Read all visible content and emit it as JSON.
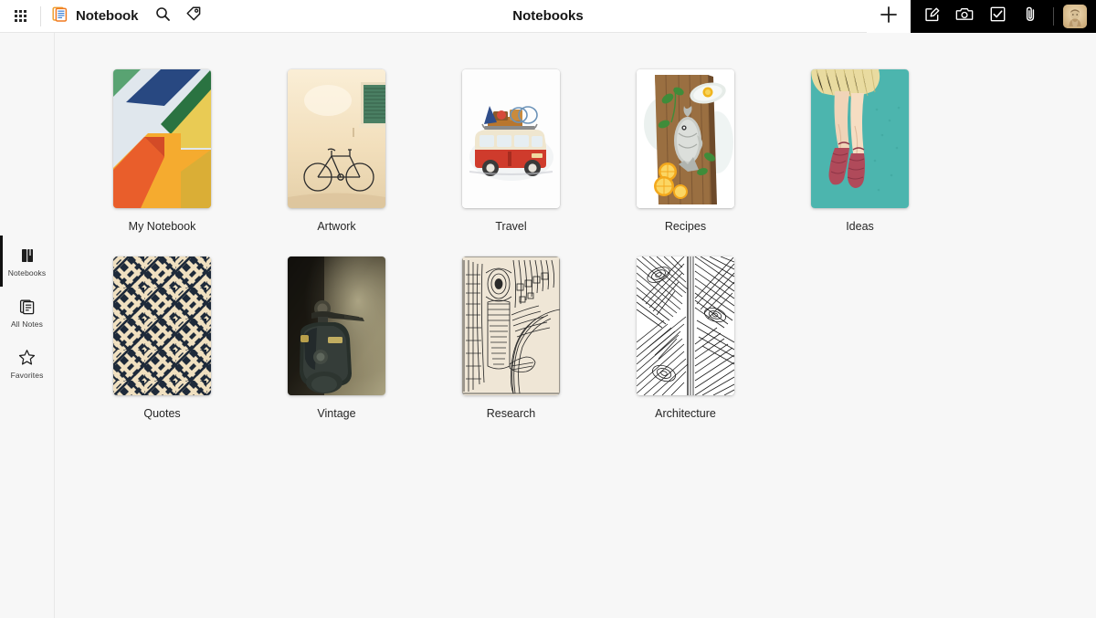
{
  "window": {
    "background": "#f7f7f7",
    "topbar_background": "#ffffff",
    "toolbar_background": "#000000"
  },
  "topbar": {
    "apps_grid_icon": "apps-grid-icon",
    "brand_icon": "notebook-app-icon",
    "brand_title": "Notebook",
    "search_icon": "search-icon",
    "tag_icon": "tag-icon",
    "page_title": "Notebooks",
    "plus_icon": "plus-icon",
    "tools": [
      {
        "name": "new-note",
        "icon": "edit-square-icon"
      },
      {
        "name": "camera-note",
        "icon": "camera-icon"
      },
      {
        "name": "checklist-note",
        "icon": "checkbox-icon"
      },
      {
        "name": "attachment-note",
        "icon": "paperclip-icon"
      }
    ],
    "avatar_name": "user-avatar"
  },
  "sidebar": {
    "items": [
      {
        "label": "Notebooks",
        "icon": "notebooks-icon",
        "active": true
      },
      {
        "label": "All Notes",
        "icon": "all-notes-icon",
        "active": false
      },
      {
        "label": "Favorites",
        "icon": "star-icon",
        "active": false
      }
    ]
  },
  "main": {
    "notebooks": [
      {
        "label": "My Notebook",
        "cover": "geometric-color-blocks",
        "colors": [
          "#1b3d7a",
          "#d9e2ea",
          "#1d6b36",
          "#e8c84a",
          "#e8541e",
          "#f5a623"
        ]
      },
      {
        "label": "Artwork",
        "cover": "bicycle-window-watercolor",
        "colors": [
          "#f6e2c3",
          "#4a7f63",
          "#2b2b2b"
        ]
      },
      {
        "label": "Travel",
        "cover": "red-van-watercolor",
        "colors": [
          "#ffffff",
          "#cf3b2c",
          "#e8dfc8"
        ]
      },
      {
        "label": "Recipes",
        "cover": "fish-board-watercolor",
        "colors": [
          "#ffffff",
          "#7a5533",
          "#c9ccc7",
          "#f0b51e"
        ]
      },
      {
        "label": "Ideas",
        "cover": "ballet-shoes-teal",
        "colors": [
          "#4cb5ae",
          "#e9dba0",
          "#b04a5a"
        ]
      },
      {
        "label": "Quotes",
        "cover": "navy-cream-weave-pattern",
        "colors": [
          "#1e2a3a",
          "#f0e0c0"
        ]
      },
      {
        "label": "Vintage",
        "cover": "dark-scooter-photo",
        "colors": [
          "#1a1712",
          "#8d8365",
          "#3a4440"
        ]
      },
      {
        "label": "Research",
        "cover": "pharaoh-line-art",
        "colors": [
          "#efe6d6",
          "#2a2a2a"
        ]
      },
      {
        "label": "Architecture",
        "cover": "geometric-line-art",
        "colors": [
          "#ffffff",
          "#1a1a1a"
        ]
      }
    ]
  }
}
